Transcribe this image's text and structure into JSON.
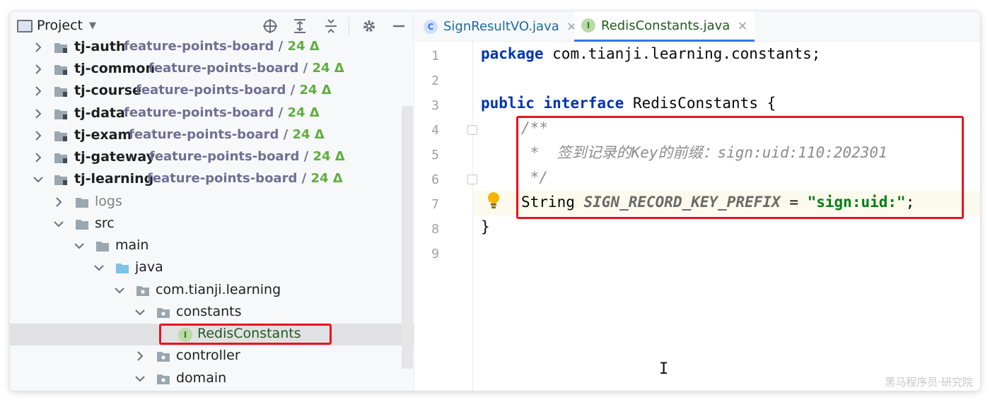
{
  "project_panel": {
    "title": "Project",
    "tree": [
      {
        "name": "tj-auth",
        "branch": "feature-points-board",
        "sep": " / ",
        "changes": "24 Δ",
        "expanded": false
      },
      {
        "name": "tj-common",
        "branch": "feature-points-board",
        "sep": " / ",
        "changes": "24 Δ",
        "expanded": false
      },
      {
        "name": "tj-course",
        "branch": "feature-points-board",
        "sep": " / ",
        "changes": "24 Δ",
        "expanded": false
      },
      {
        "name": "tj-data",
        "branch": "feature-points-board",
        "sep": " / ",
        "changes": "24 Δ",
        "expanded": false
      },
      {
        "name": "tj-exam",
        "branch": "feature-points-board",
        "sep": " / ",
        "changes": "24 Δ",
        "expanded": false
      },
      {
        "name": "tj-gateway",
        "branch": "feature-points-board",
        "sep": " / ",
        "changes": "24 Δ",
        "expanded": false
      },
      {
        "name": "tj-learning",
        "branch": "feature-points-board",
        "sep": " / ",
        "changes": "24 Δ",
        "expanded": true
      },
      {
        "name": "logs"
      },
      {
        "name": "src"
      },
      {
        "name": "main"
      },
      {
        "name": "java"
      },
      {
        "name": "com.tianji.learning"
      },
      {
        "name": "constants"
      },
      {
        "name": "RedisConstants",
        "icon_letter": "I",
        "selected": true
      },
      {
        "name": "controller"
      },
      {
        "name": "domain"
      }
    ]
  },
  "editor": {
    "tabs": [
      {
        "label": "SignResultVO.java",
        "icon_letter": "C",
        "close": "×",
        "active": false
      },
      {
        "label": "RedisConstants.java",
        "icon_letter": "I",
        "close": "×",
        "active": true
      }
    ],
    "line_numbers": [
      "1",
      "2",
      "3",
      "4",
      "5",
      "6",
      "7",
      "8",
      "9"
    ],
    "code": {
      "l1_kw": "package",
      "l1_rest": " com.tianji.learning.constants;",
      "l3_kw1": "public",
      "l3_kw2": "interface",
      "l3_rest": " RedisConstants {",
      "l4": "/**",
      "l5": " *  签到记录的Key的前缀：sign:uid:110:202301",
      "l6": " */",
      "l7_type": "String ",
      "l7_field": "SIGN_RECORD_KEY_PREFIX",
      "l7_eq": " = ",
      "l7_str": "\"sign:uid:\"",
      "l7_end": ";",
      "l8": "}"
    }
  },
  "overlay": {
    "text_cursor": "I",
    "watermark": "黑马程序员·研究院"
  },
  "colors": {
    "highlight_red": "#e8131f",
    "keyword": "#0033b3",
    "string": "#067d17",
    "comment": "#8c8c8c",
    "branch": "#6f6f95",
    "delta": "#5fae3e"
  }
}
